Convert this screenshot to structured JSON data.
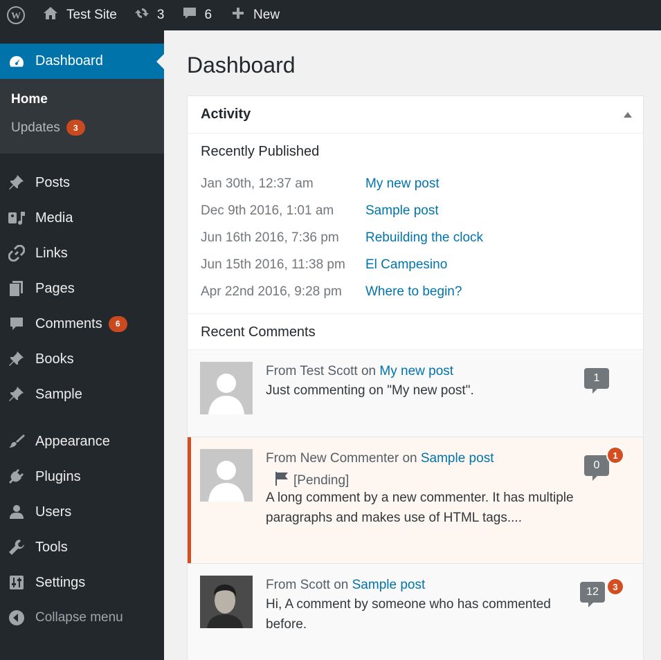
{
  "adminbar": {
    "site_title": "Test Site",
    "updates_count": "3",
    "comments_count": "6",
    "new_label": "New"
  },
  "sidebar": {
    "dashboard_label": "Dashboard",
    "home_label": "Home",
    "updates_label": "Updates",
    "updates_badge": "3",
    "items": [
      {
        "label": "Posts",
        "icon": "pin-icon"
      },
      {
        "label": "Media",
        "icon": "media-icon"
      },
      {
        "label": "Links",
        "icon": "link-icon"
      },
      {
        "label": "Pages",
        "icon": "pages-icon"
      },
      {
        "label": "Comments",
        "icon": "comment-icon",
        "badge": "6"
      },
      {
        "label": "Books",
        "icon": "pin-icon"
      },
      {
        "label": "Sample",
        "icon": "pin-icon"
      },
      {
        "label": "Appearance",
        "icon": "brush-icon"
      },
      {
        "label": "Plugins",
        "icon": "plug-icon"
      },
      {
        "label": "Users",
        "icon": "user-icon"
      },
      {
        "label": "Tools",
        "icon": "wrench-icon"
      },
      {
        "label": "Settings",
        "icon": "sliders-icon"
      }
    ],
    "collapse_label": "Collapse menu"
  },
  "main": {
    "page_title": "Dashboard",
    "activity": {
      "title": "Activity",
      "recently_published_title": "Recently Published",
      "published": [
        {
          "date": "Jan 30th, 12:37 am",
          "title": "My new post"
        },
        {
          "date": "Dec 9th 2016, 1:01 am",
          "title": "Sample post"
        },
        {
          "date": "Jun 16th 2016, 7:36 pm",
          "title": "Rebuilding the clock"
        },
        {
          "date": "Jun 15th 2016, 11:38 pm",
          "title": "El Campesino"
        },
        {
          "date": "Apr 22nd 2016, 9:28 pm",
          "title": "Where to begin?"
        }
      ],
      "recent_comments_title": "Recent Comments",
      "comments": [
        {
          "from_prefix": "From",
          "author": "Test Scott",
          "on_word": "on",
          "post": "My new post",
          "text": "Just commenting on \"My new post\".",
          "approved_count": "1"
        },
        {
          "from_prefix": "From",
          "author": "New Commenter",
          "on_word": "on",
          "post": "Sample post",
          "pending_label": "[Pending]",
          "text": "A long comment by a new commenter. It has multiple paragraphs and makes use of HTML tags....",
          "approved_count": "0",
          "pending_count": "1"
        },
        {
          "from_prefix": "From",
          "author": "Scott",
          "on_word": "on",
          "post": "Sample post",
          "text": "Hi, A comment by someone who has commented before.",
          "approved_count": "12",
          "pending_count": "3"
        }
      ]
    }
  },
  "colors": {
    "adminbar_bg": "#23282d",
    "menu_active": "#0073aa",
    "link": "#0073aa",
    "badge": "#d54e21"
  }
}
